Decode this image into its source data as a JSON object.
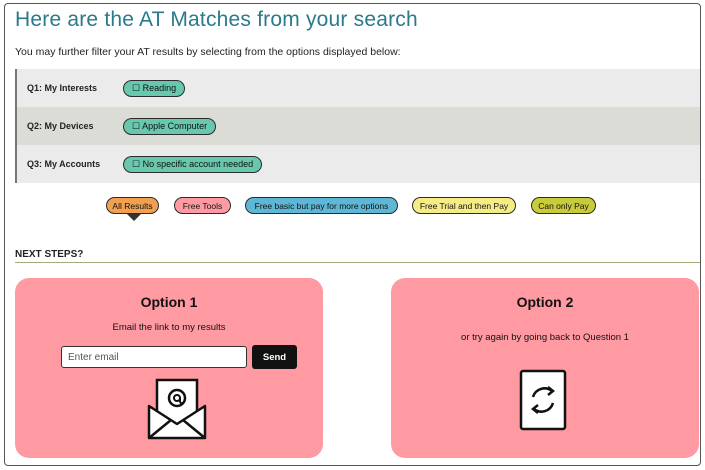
{
  "header": {
    "title": "Here are the AT Matches from your search",
    "subtitle": "You may further filter your AT results by selecting from the options displayed below:"
  },
  "questions": [
    {
      "label": "Q1: My Interests",
      "tag": "☐ Reading"
    },
    {
      "label": "Q2: My Devices",
      "tag": "☐ Apple Computer"
    },
    {
      "label": "Q3: My Accounts",
      "tag": "☐ No specific account needed"
    }
  ],
  "filters": [
    {
      "label": "All Results",
      "color": "#f0a050",
      "selected": true
    },
    {
      "label": "Free Tools",
      "color": "#ff9aa2"
    },
    {
      "label": "Free basic but pay for more options",
      "color": "#5fb7d6"
    },
    {
      "label": "Free Trial and then Pay",
      "color": "#f5ec86"
    },
    {
      "label": "Can only Pay",
      "color": "#c8cc3a"
    }
  ],
  "next_steps": {
    "heading": "NEXT STEPS?",
    "option1": {
      "title": "Option 1",
      "text": "Email the link to my results",
      "email_placeholder": "Enter email",
      "send_label": "Send",
      "icon": "envelope-at-icon"
    },
    "option2": {
      "title": "Option 2",
      "text": "or try again by going back to Question 1",
      "icon": "refresh-icon"
    }
  },
  "colors": {
    "title": "#2a7a8c",
    "tag": "#67c8ad",
    "card": "#ff9aa2"
  }
}
